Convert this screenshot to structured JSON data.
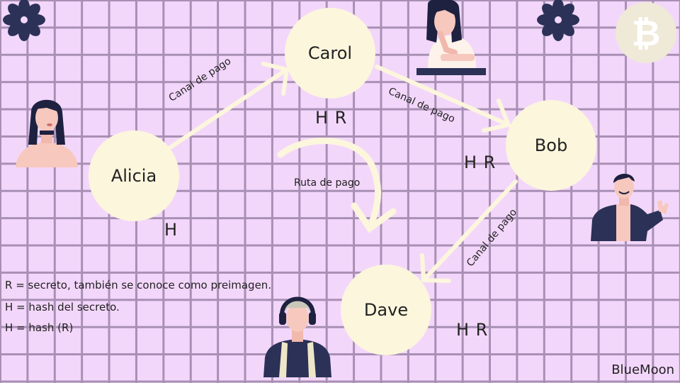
{
  "nodes": {
    "alicia": "Alicia",
    "carol": "Carol",
    "bob": "Bob",
    "dave": "Dave"
  },
  "edges": {
    "alicia_carol": "Canal de pago",
    "carol_bob": "Canal de pago",
    "bob_dave": "Canal de pago",
    "route": "Ruta de pago"
  },
  "node_marks": {
    "alicia": "H",
    "carol": "H R",
    "bob": "H R",
    "dave": "H R"
  },
  "legend": [
    "R = secreto, también se conoce como preimagen.",
    "H = hash del secreto.",
    "H = hash (R)"
  ],
  "brand": "BlueMoon",
  "colors": {
    "background": "#f3d7fb",
    "grid": "#a88fb4",
    "node_fill": "#fcf6dd",
    "arrow": "#fcf6dd",
    "flower": "#2b3157",
    "coin": "#efe9d7"
  },
  "icons": [
    "flower-icon",
    "flower-icon",
    "bitcoin-coin-icon"
  ]
}
